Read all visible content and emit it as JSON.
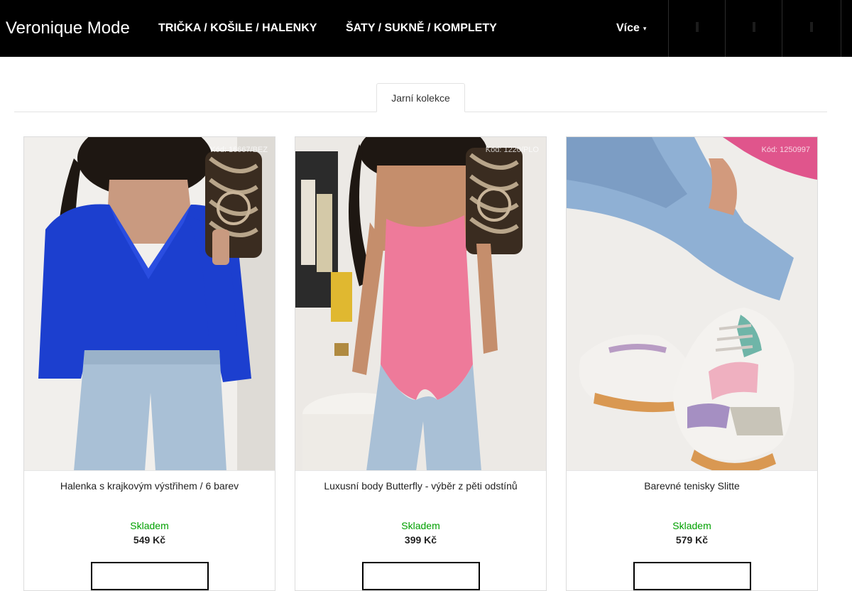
{
  "header": {
    "logo": "Veronique Mode",
    "nav": [
      {
        "label": "TRIČKA / KOŠILE / HALENKY"
      },
      {
        "label": "ŠATY / SUKNĚ / KOMPLETY"
      }
    ],
    "more_label": "Více",
    "icons": [
      "search-icon",
      "user-icon",
      "cart-icon"
    ]
  },
  "tabs": [
    {
      "label": "Jarní kolekce",
      "active": true
    }
  ],
  "products": [
    {
      "code": "Kód: 16667/BEZ",
      "name": "Halenka s krajkovým výstřihem / 6 barev",
      "stock": "Skladem",
      "price": "549 Kč",
      "image": "woman-blue-lace-blouse-jeans-photo"
    },
    {
      "code": "Kód: 1220/PLO",
      "name": "Luxusní body Butterfly - výběr z pěti odstínů",
      "stock": "Skladem",
      "price": "399 Kč",
      "image": "woman-pink-body-jeans-photo"
    },
    {
      "code": "Kód: 1250997",
      "name": "Barevné tenisky Slitte",
      "stock": "Skladem",
      "price": "579 Kč",
      "image": "pastel-sneakers-photo"
    }
  ],
  "colors": {
    "header_bg": "#000000",
    "stock_green": "#00a000",
    "border": "#dcdcdc"
  }
}
